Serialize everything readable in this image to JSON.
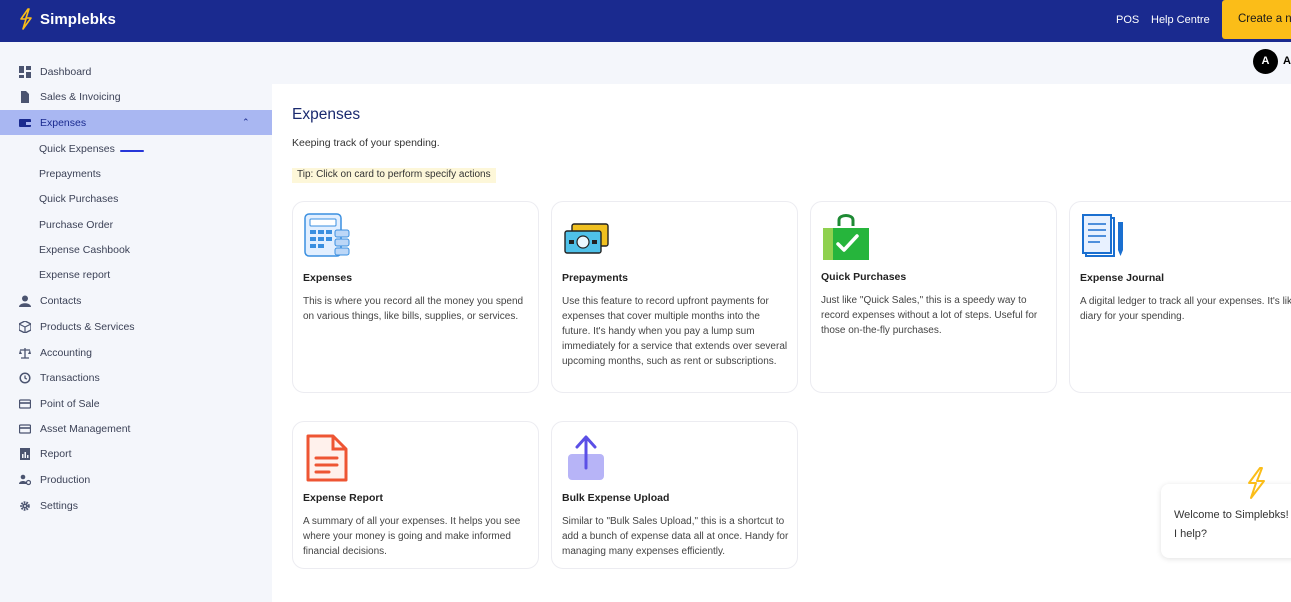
{
  "app": {
    "name": "Simplebks",
    "colors": {
      "brand_navy": "#1a2a8f",
      "accent_yellow": "#fbbd18",
      "active_nav": "#a9b7f2"
    }
  },
  "header": {
    "pos_label": "POS",
    "help_label": "Help Centre",
    "create_label": "Create a new"
  },
  "user": {
    "initial": "A",
    "name": "A"
  },
  "sidebar": {
    "items": [
      {
        "label": "Dashboard",
        "icon": "dashboard-icon"
      },
      {
        "label": "Sales & Invoicing",
        "icon": "document-icon"
      },
      {
        "label": "Expenses",
        "icon": "wallet-icon",
        "active": true
      },
      {
        "label": "Contacts",
        "icon": "person-icon"
      },
      {
        "label": "Products & Services",
        "icon": "box-icon"
      },
      {
        "label": "Accounting",
        "icon": "scale-icon"
      },
      {
        "label": "Transactions",
        "icon": "history-icon"
      },
      {
        "label": "Point of Sale",
        "icon": "card-icon"
      },
      {
        "label": "Asset Management",
        "icon": "card-icon"
      },
      {
        "label": "Report",
        "icon": "report-icon"
      },
      {
        "label": "Production",
        "icon": "people-gear-icon"
      },
      {
        "label": "Settings",
        "icon": "gear-icon"
      }
    ],
    "expenses_sub": [
      "Quick Expenses",
      "Prepayments",
      "Quick Purchases",
      "Purchase Order",
      "Expense Cashbook",
      "Expense report"
    ]
  },
  "page": {
    "title": "Expenses",
    "subtitle": "Keeping track of your spending.",
    "tip": "Tip: Click on card to perform specify actions"
  },
  "cards": [
    {
      "title": "Expenses",
      "icon": "calculator-icon",
      "desc": "This is where you record all the money you spend on various things, like bills, supplies, or services."
    },
    {
      "title": "Prepayments",
      "icon": "cash-icon",
      "desc": "Use this feature to record upfront payments for expenses that cover multiple months into the future. It's handy when you pay a lump sum immediately for a service that extends over several upcoming months, such as rent or subscriptions."
    },
    {
      "title": "Quick Purchases",
      "icon": "shopping-bag-icon",
      "desc": "Just like \"Quick Sales,\" this is a speedy way to record expenses without a lot of steps. Useful for those on-the-fly purchases."
    },
    {
      "title": "Expense Journal",
      "icon": "journal-icon",
      "desc": "A digital ledger to track all your expenses. It's like a diary for your spending."
    },
    {
      "title": "Expense Report",
      "icon": "report-doc-icon",
      "desc": "A summary of all your expenses. It helps you see where your money is going and make informed financial decisions."
    },
    {
      "title": "Bulk Expense Upload",
      "icon": "upload-icon",
      "desc": "Similar to \"Bulk Sales Upload,\" this is a shortcut to add a bunch of expense data all at once. Handy for managing many expenses efficiently."
    }
  ],
  "chat": {
    "line1": "Welcome to Simplebks! How can",
    "line2": "I help?"
  }
}
